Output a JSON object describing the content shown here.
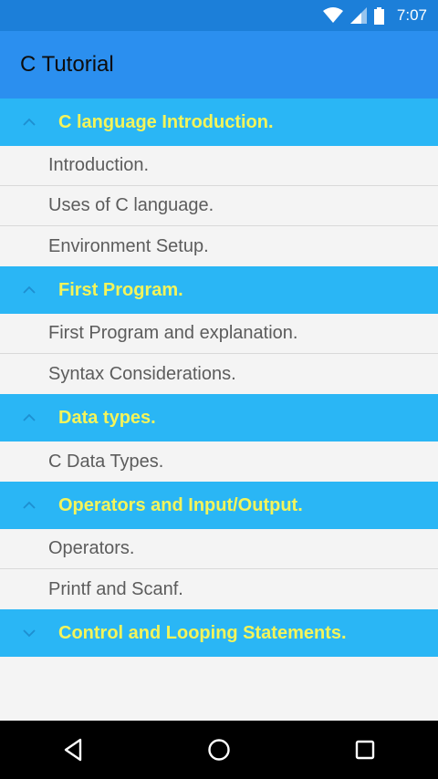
{
  "status": {
    "time": "7:07"
  },
  "app": {
    "title": "C Tutorial"
  },
  "groups": [
    {
      "label": "C language Introduction.",
      "expanded": true,
      "items": [
        "Introduction.",
        "Uses of C language.",
        "Environment Setup."
      ]
    },
    {
      "label": "First Program.",
      "expanded": true,
      "items": [
        "First Program and explanation.",
        "Syntax Considerations."
      ]
    },
    {
      "label": "Data types.",
      "expanded": true,
      "items": [
        "C Data Types."
      ]
    },
    {
      "label": "Operators and Input/Output.",
      "expanded": true,
      "items": [
        "Operators.",
        "Printf and Scanf."
      ]
    },
    {
      "label": "Control and Looping Statements.",
      "expanded": false,
      "items": []
    }
  ],
  "colors": {
    "status_bar": "#1c7fd9",
    "app_bar": "#2b8fef",
    "group_header": "#2ab6f5",
    "group_label": "#f4f45a",
    "child_text": "#5c5c5c"
  },
  "icons": {
    "expanded": "chevron-up-icon",
    "collapsed": "chevron-down-icon",
    "nav": [
      "back-icon",
      "home-icon",
      "recents-icon"
    ]
  }
}
